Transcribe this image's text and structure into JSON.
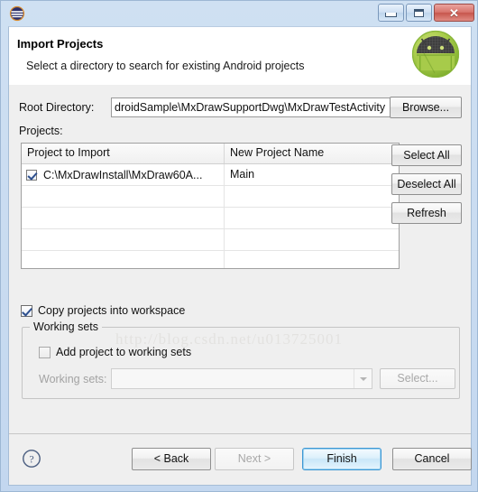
{
  "window": {
    "icon": "eclipse-globe-icon",
    "controls": {
      "minimize": "minimize-icon",
      "maximize": "maximize-icon",
      "close": "✕"
    }
  },
  "header": {
    "title": "Import Projects",
    "subtitle": "Select a directory to search for existing Android projects",
    "logo": "android-robot-icon"
  },
  "root_directory": {
    "label": "Root Directory:",
    "value": "droidSample\\MxDrawSupportDwg\\MxDrawTestActivity",
    "browse_label": "Browse..."
  },
  "projects": {
    "label": "Projects:",
    "columns": [
      "Project to Import",
      "New Project Name"
    ],
    "rows": [
      {
        "checked": true,
        "project": "C:\\MxDrawInstall\\MxDraw60A...",
        "name": "Main"
      },
      {
        "checked": null,
        "project": "",
        "name": ""
      },
      {
        "checked": null,
        "project": "",
        "name": ""
      },
      {
        "checked": null,
        "project": "",
        "name": ""
      },
      {
        "checked": null,
        "project": "",
        "name": ""
      },
      {
        "checked": null,
        "project": "",
        "name": ""
      }
    ],
    "buttons": {
      "select_all": "Select All",
      "deselect_all": "Deselect All",
      "refresh": "Refresh"
    }
  },
  "watermark": "http://blog.csdn.net/u013725001",
  "options": {
    "copy_projects": {
      "label": "Copy projects into workspace",
      "checked": true
    }
  },
  "working_sets": {
    "group_title": "Working sets",
    "add_project": {
      "label": "Add project to working sets",
      "checked": false
    },
    "combo_label": "Working sets:",
    "combo_value": "",
    "select_label": "Select..."
  },
  "footer": {
    "help": "?",
    "back": "< Back",
    "next": "Next >",
    "finish": "Finish",
    "cancel": "Cancel"
  },
  "colors": {
    "accent": "#3c97d4",
    "android_green": "#9ac63f",
    "window_frame": "#c3d7ef",
    "dialog_bg": "#efefef"
  }
}
